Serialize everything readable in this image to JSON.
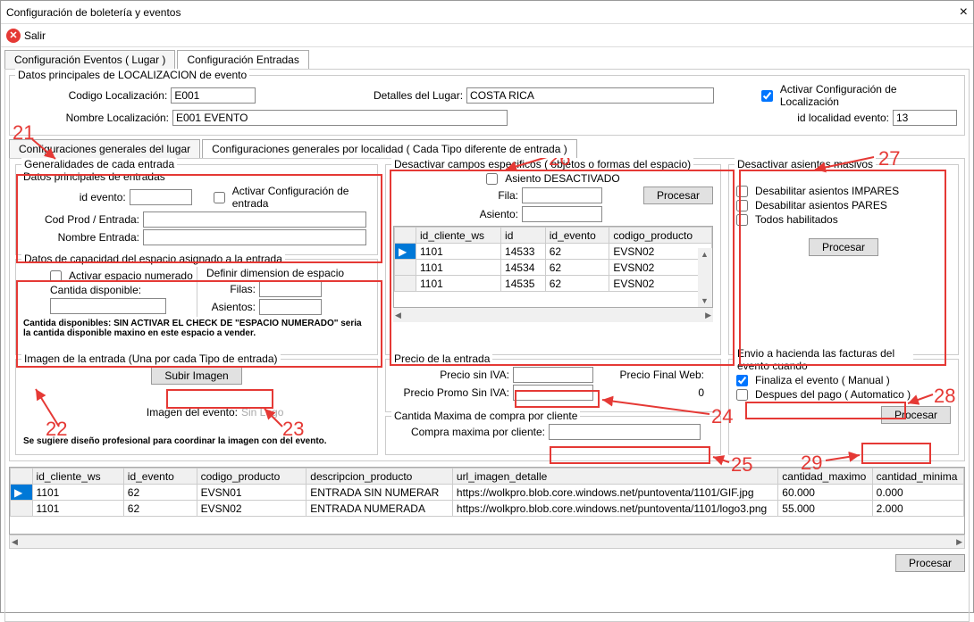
{
  "window": {
    "title": "Configuración de boletería y eventos"
  },
  "toolbar": {
    "exit_label": "Salir"
  },
  "main_tabs": [
    "Configuración Eventos ( Lugar )",
    "Configuración Entradas"
  ],
  "loc_group": {
    "title": "Datos principales de LOCALIZACION de evento",
    "codigo_label": "Codigo Localización:",
    "codigo_value": "E001",
    "detalles_label": "Detalles del Lugar:",
    "detalles_value": "COSTA RICA",
    "activar_label": "Activar Configuración de Localización",
    "nombre_label": "Nombre Localización:",
    "nombre_value": "E001 EVENTO",
    "id_local_label": "id localidad evento:",
    "id_local_value": "13"
  },
  "sub_tabs": [
    "Configuraciones generales del lugar",
    "Configuraciones generales por localidad ( Cada Tipo diferente de entrada )"
  ],
  "gen": {
    "title": "Generalidades de cada entrada",
    "datos_title": "Datos principales de entradas",
    "id_evento_label": "id evento:",
    "id_evento_value": "",
    "activar_entrada": "Activar Configuración de entrada",
    "cod_prod_label": "Cod Prod / Entrada:",
    "cod_prod_value": "",
    "nombre_entrada_label": "Nombre Entrada:",
    "nombre_entrada_value": "",
    "cap_title": "Datos de capacidad del espacio asignado a la entrada",
    "activar_num": "Activar espacio numerado",
    "cantidad_label": "Cantida disponible:",
    "cantidad_value": "",
    "dim_title": "Definir dimension de espacio",
    "filas_label": "Filas:",
    "filas_value": "",
    "asientos_label": "Asientos:",
    "asientos_value": "",
    "nota": "Cantida disponibles: SIN ACTIVAR EL CHECK DE \"ESPACIO NUMERADO\" seria la cantida disponible maxino en este espacio  a vender."
  },
  "imagen": {
    "title": "Imagen de la entrada (Una por cada Tipo de entrada)",
    "subir_btn": "Subir Imagen",
    "img_label": "Imagen del evento:",
    "img_value": "Sin Logo",
    "nota": "Se sugiere diseño profesional para coordinar la imagen con del evento."
  },
  "desact": {
    "title": "Desactivar campos especificos ( objetos o formas del espacio)",
    "asiento_chk": "Asiento DESACTIVADO",
    "fila_label": "Fila:",
    "asiento_label": "Asiento:",
    "procesar": "Procesar",
    "cols": [
      "id_cliente_ws",
      "id",
      "id_evento",
      "codigo_producto"
    ],
    "rows": [
      [
        "1101",
        "14533",
        "62",
        "EVSN02"
      ],
      [
        "1101",
        "14534",
        "62",
        "EVSN02"
      ],
      [
        "1101",
        "14535",
        "62",
        "EVSN02"
      ]
    ]
  },
  "masivo": {
    "title": "Desactivar asientos masivos",
    "impares": "Desabilitar asientos IMPARES",
    "pares": "Desabilitar asientos PARES",
    "todos": "Todos habilitados",
    "procesar": "Procesar"
  },
  "precio": {
    "title": "Precio de la entrada",
    "sin_iva_label": "Precio sin IVA:",
    "sin_iva_value": "",
    "final_label": "Precio Final Web:",
    "promo_label": "Precio Promo Sin IVA:",
    "promo_value": "",
    "promo_final": "0"
  },
  "compra": {
    "title": "Cantida Maxima de compra por cliente",
    "max_label": "Compra maxima por cliente:",
    "max_value": ""
  },
  "hacienda": {
    "title": "Envio a hacienda las facturas del evento cuando",
    "finaliza": "Finaliza el evento ( Manual )",
    "despues": "Despues del pago ( Automatico )",
    "procesar": "Procesar"
  },
  "bottom_table": {
    "cols": [
      "id_cliente_ws",
      "id_evento",
      "codigo_producto",
      "descripcion_producto",
      "url_imagen_detalle",
      "cantidad_maximo",
      "cantidad_minima"
    ],
    "rows": [
      [
        "1101",
        "62",
        "EVSN01",
        "ENTRADA SIN NUMERAR",
        "https://wolkpro.blob.core.windows.net/puntoventa/1101/GIF.jpg",
        "60.000",
        "0.000"
      ],
      [
        "1101",
        "62",
        "EVSN02",
        "ENTRADA NUMERADA",
        "https://wolkpro.blob.core.windows.net/puntoventa/1101/logo3.png",
        "55.000",
        "2.000"
      ]
    ]
  },
  "procesar_btn": "Procesar",
  "annotations": {
    "a21": "21",
    "a22": "22",
    "a23": "23",
    "a24": "24",
    "a25": "25",
    "a26": "26",
    "a27": "27",
    "a28": "28",
    "a29": "29"
  }
}
